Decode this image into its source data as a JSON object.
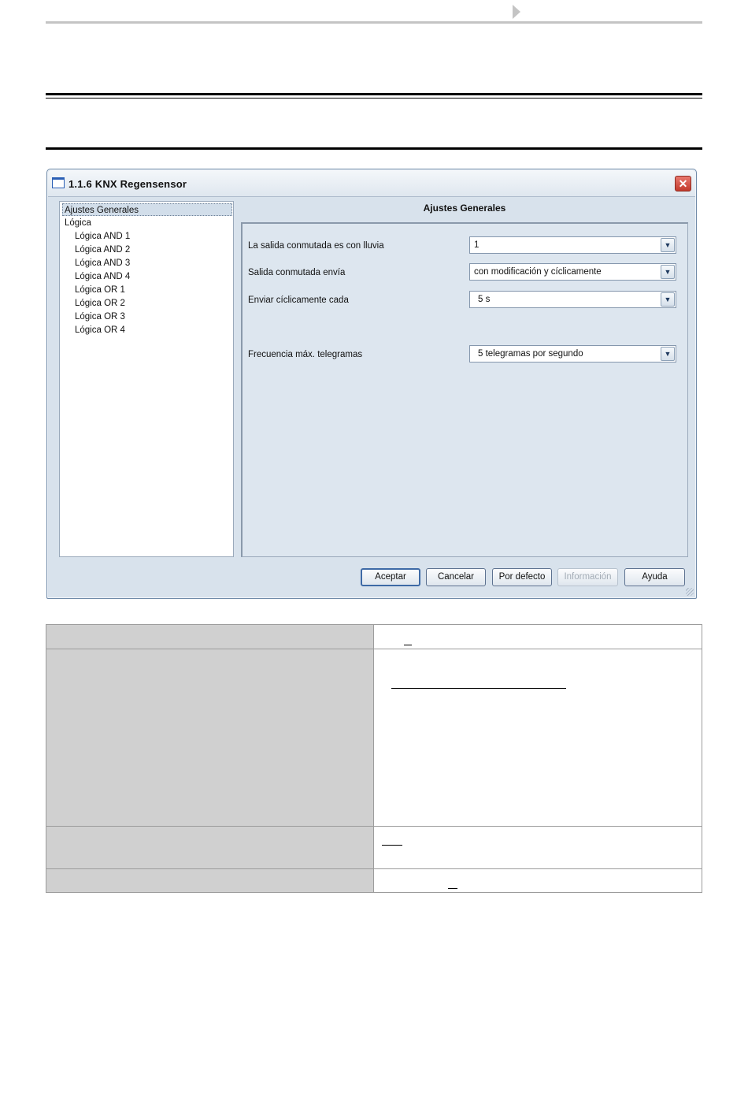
{
  "window": {
    "title": "1.1.6 KNX Regensensor",
    "close_glyph": "✕"
  },
  "tree": {
    "items": [
      {
        "label": "Ajustes Generales",
        "selected": true
      },
      {
        "label": "Lógica"
      },
      {
        "label": "Lógica AND 1"
      },
      {
        "label": "Lógica AND 2"
      },
      {
        "label": "Lógica AND 3"
      },
      {
        "label": "Lógica AND 4"
      },
      {
        "label": "Lógica OR 1"
      },
      {
        "label": "Lógica OR 2"
      },
      {
        "label": "Lógica OR 3"
      },
      {
        "label": "Lógica OR 4"
      }
    ]
  },
  "panel": {
    "title": "Ajustes Generales",
    "params": [
      {
        "label": "La salida conmutada es con lluvia",
        "value": "1"
      },
      {
        "label": "Salida conmutada envía",
        "value": "con modificación y cíclicamente"
      },
      {
        "label": "Enviar cíclicamente cada",
        "value": "5 s"
      },
      {
        "label": "Frecuencia máx. telegramas",
        "value": "5 telegramas por segundo"
      }
    ]
  },
  "buttons": {
    "accept": "Aceptar",
    "cancel": "Cancelar",
    "defaults": "Por defecto",
    "info": "Información",
    "help": "Ayuda"
  },
  "icons": {
    "dropdown": "chevron-down-icon",
    "app": "window-icon",
    "close": "close-icon"
  },
  "colors": {
    "window_bg": "#d8e2ec",
    "close_red": "#c23a2c",
    "table_label_bg": "#d0d0d0"
  }
}
